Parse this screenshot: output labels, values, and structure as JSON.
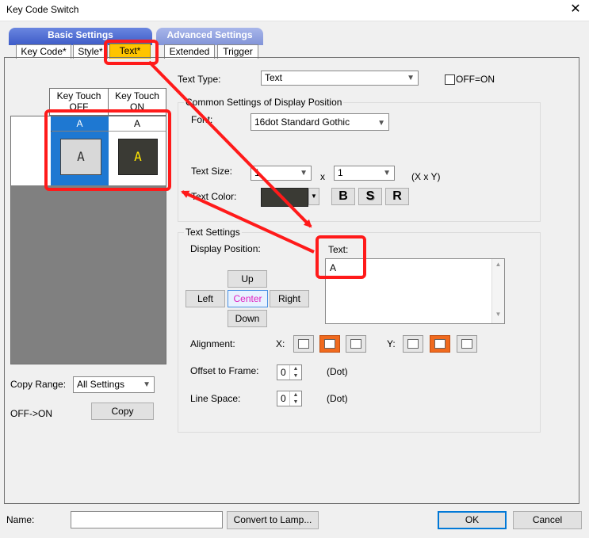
{
  "window": {
    "title": "Key Code Switch",
    "close_glyph": "✕"
  },
  "group_tabs": {
    "basic": "Basic Settings",
    "advanced": "Advanced Settings"
  },
  "tabs": {
    "key_code": "Key Code*",
    "style": "Style*",
    "text": "Text*",
    "extended": "Extended",
    "trigger": "Trigger"
  },
  "preview": {
    "col_off": "Key Touch\nOFF",
    "col_on": "Key Touch\nON",
    "cell_off_label": "A",
    "cell_on_label": "A",
    "sample_off": "A",
    "sample_on": "A"
  },
  "copy": {
    "range_label": "Copy Range:",
    "range_value": "All Settings",
    "off_on_label": "OFF->ON",
    "copy_button": "Copy"
  },
  "text_type": {
    "label": "Text Type:",
    "value": "Text",
    "off_on_label": "OFF=ON"
  },
  "common": {
    "group_label": "Common Settings of Display Position",
    "font_label": "Font:",
    "font_value": "16dot Standard Gothic",
    "size_label": "Text Size:",
    "size_x": "1",
    "size_y": "1",
    "x_label": "x",
    "unit": "(X x Y)",
    "color_label": "Text Color:",
    "bold": "B",
    "shadow": "S",
    "reverse": "R"
  },
  "text_settings": {
    "group_label": "Text Settings",
    "display_position_label": "Display Position:",
    "text_label": "Text:",
    "text_value": "A",
    "up": "Up",
    "left": "Left",
    "center": "Center",
    "right": "Right",
    "down": "Down",
    "alignment_label": "Alignment:",
    "x_label": "X:",
    "y_label": "Y:",
    "offset_label": "Offset to Frame:",
    "offset_value": "0",
    "offset_unit": "(Dot)",
    "linespace_label": "Line Space:",
    "linespace_value": "0",
    "linespace_unit": "(Dot)"
  },
  "footer": {
    "name_label": "Name:",
    "name_value": "",
    "convert_button": "Convert to Lamp...",
    "ok_button": "OK",
    "cancel_button": "Cancel"
  },
  "colors": {
    "accent_red": "#ff1a1a",
    "tab_blue": "#4a64c8",
    "tab_active": "#ffc400",
    "selected_blue": "#1e78d2"
  }
}
